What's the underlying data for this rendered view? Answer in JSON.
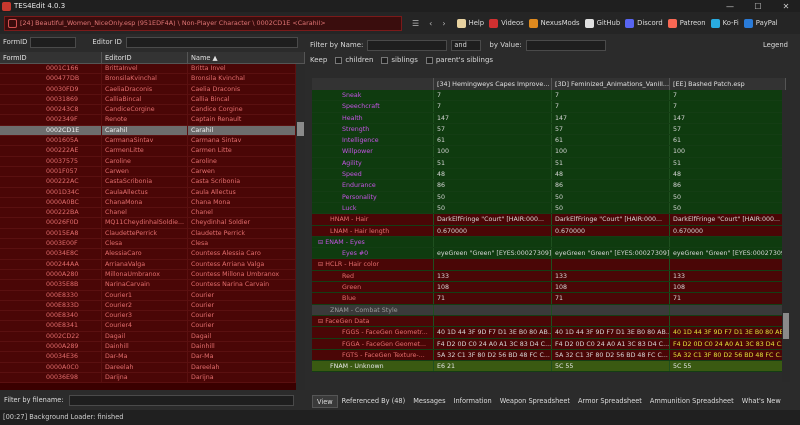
{
  "app": {
    "title": "TES4Edit 4.0.3"
  },
  "window_controls": {
    "min": "—",
    "max": "☐",
    "close": "✕"
  },
  "toolbar": {
    "path": "[24] Beautiful_Women_NiceOnly.esp (951EDF4A) \\ Non-Player Character \\ 0002CD1E <Carahil>",
    "menu_icon": "☰",
    "back": "‹",
    "fwd": "›",
    "links": [
      {
        "label": "Help",
        "icon": "book-icon",
        "color": "#e8d2a0"
      },
      {
        "label": "Videos",
        "icon": "video-icon",
        "color": "#d03030"
      },
      {
        "label": "NexusMods",
        "icon": "nexus-icon",
        "color": "#e08a1e"
      },
      {
        "label": "GitHub",
        "icon": "github-icon",
        "color": "#e0e0e0"
      },
      {
        "label": "Discord",
        "icon": "discord-icon",
        "color": "#5865f2"
      },
      {
        "label": "Patreon",
        "icon": "patreon-icon",
        "color": "#f96854"
      },
      {
        "label": "Ko-Fi",
        "icon": "kofi-icon",
        "color": "#29abe0"
      },
      {
        "label": "PayPal",
        "icon": "paypal-icon",
        "color": "#2a7bd8"
      }
    ]
  },
  "left": {
    "formid_label": "FormID",
    "editorid_label": "Editor ID",
    "columns": [
      "FormID",
      "EditorID",
      "Name ▲"
    ],
    "rows": [
      [
        "0001C166",
        "BrittaInvel",
        "Britta Invel"
      ],
      [
        "000477DB",
        "BronsilaKvinchal",
        "Bronsila Kvinchal"
      ],
      [
        "00030FD9",
        "CaeliaDraconis",
        "Caelia Draconis"
      ],
      [
        "00031869",
        "CalliaBincal",
        "Callia Bincal"
      ],
      [
        "000243C8",
        "CandiceCorgine",
        "Candice Corgine"
      ],
      [
        "0002349F",
        "Renote",
        "Captain Renault"
      ],
      [
        "0002CD1E",
        "Carahil",
        "Carahil"
      ],
      [
        "0001605A",
        "CarmanaSintav",
        "Carmana Sintav"
      ],
      [
        "000222AE",
        "CarmenLitte",
        "Carmen Litte"
      ],
      [
        "00037575",
        "Caroline",
        "Caroline"
      ],
      [
        "0001F057",
        "Carwen",
        "Carwen"
      ],
      [
        "000222AC",
        "CastaScribonia",
        "Casta Scribonia"
      ],
      [
        "0001D34C",
        "CaulaAllectus",
        "Caula Allectus"
      ],
      [
        "0000A0BC",
        "ChanaMona",
        "Chana Mona"
      ],
      [
        "000222BA",
        "Chanel",
        "Chanel"
      ],
      [
        "00026F0D",
        "MQ11CheydinhalSoldie...",
        "Cheydinhal Soldier"
      ],
      [
        "00015EA8",
        "ClaudettePerrick",
        "Claudette Perrick"
      ],
      [
        "0003E00F",
        "Clesa",
        "Clesa"
      ],
      [
        "00034E8C",
        "AlessiaCaro",
        "Countess Alessia Caro"
      ],
      [
        "000244AA",
        "ArrianaValga",
        "Countess Arriana Valga"
      ],
      [
        "0000A280",
        "MillonaUmbranox",
        "Countess Millona Umbranox"
      ],
      [
        "00035E8B",
        "NarinaCarvain",
        "Countess Narina Carvain"
      ],
      [
        "000E8330",
        "Courier1",
        "Courier"
      ],
      [
        "000E833D",
        "Courier2",
        "Courier"
      ],
      [
        "000E8340",
        "Courier3",
        "Courier"
      ],
      [
        "000E8341",
        "Courier4",
        "Courier"
      ],
      [
        "0002CD22",
        "Dagail",
        "Dagail"
      ],
      [
        "0000A289",
        "Dainhill",
        "Dainhill"
      ],
      [
        "00034E36",
        "Dar-Ma",
        "Dar-Ma"
      ],
      [
        "0000A0C0",
        "Dareelah",
        "Dareelah"
      ],
      [
        "00036E98",
        "Darijna",
        "Darijna"
      ]
    ],
    "filter_label": "Filter by filename:"
  },
  "right": {
    "filter_name_label": "Filter by Name:",
    "and_value": "and",
    "by_value_label": "by Value:",
    "legend": "Legend",
    "keep_label": "Keep",
    "keep_children": "children",
    "keep_siblings": "siblings",
    "keep_parents": "parent's siblings",
    "columns": [
      "",
      "[34] Hemingweys Capes Improve...",
      "[3D] Feminized_Animations_Vanill...",
      "[EE] Bashed Patch.esp"
    ],
    "rows": [
      {
        "cls": "g",
        "name": "Sneak",
        "indent": 2,
        "v": [
          "7",
          "7",
          "7"
        ]
      },
      {
        "cls": "g",
        "name": "Speechcraft",
        "indent": 2,
        "v": [
          "7",
          "7",
          "7"
        ]
      },
      {
        "cls": "g",
        "name": "Health",
        "indent": 2,
        "v": [
          "147",
          "147",
          "147"
        ]
      },
      {
        "cls": "g",
        "name": "Strength",
        "indent": 2,
        "v": [
          "57",
          "57",
          "57"
        ]
      },
      {
        "cls": "g",
        "name": "Intelligence",
        "indent": 2,
        "v": [
          "61",
          "61",
          "61"
        ]
      },
      {
        "cls": "g",
        "name": "Willpower",
        "indent": 2,
        "v": [
          "100",
          "100",
          "100"
        ]
      },
      {
        "cls": "g",
        "name": "Agility",
        "indent": 2,
        "v": [
          "51",
          "51",
          "51"
        ]
      },
      {
        "cls": "g",
        "name": "Speed",
        "indent": 2,
        "v": [
          "48",
          "48",
          "48"
        ]
      },
      {
        "cls": "g",
        "name": "Endurance",
        "indent": 2,
        "v": [
          "86",
          "86",
          "86"
        ]
      },
      {
        "cls": "g",
        "name": "Personality",
        "indent": 2,
        "v": [
          "50",
          "50",
          "50"
        ]
      },
      {
        "cls": "g",
        "name": "Luck",
        "indent": 2,
        "v": [
          "50",
          "50",
          "50"
        ]
      },
      {
        "cls": "r",
        "name": "HNAM - Hair",
        "indent": 1,
        "v": [
          "DarkElfFringe \"Court\" [HAIR:000...",
          "DarkElfFringe \"Court\" [HAIR:000...",
          "DarkElfFringe \"Court\" [HAIR:000..."
        ]
      },
      {
        "cls": "r",
        "name": "LNAM - Hair length",
        "indent": 1,
        "v": [
          "0.670000",
          "0.670000",
          "0.670000"
        ]
      },
      {
        "cls": "g",
        "name": "⊟ ENAM - Eyes",
        "indent": 0,
        "v": [
          "",
          "",
          ""
        ]
      },
      {
        "cls": "g",
        "name": "Eyes #0",
        "indent": 2,
        "v": [
          "eyeGreen \"Green\" [EYES:00027309]",
          "eyeGreen \"Green\" [EYES:00027309]",
          "eyeGreen \"Green\" [EYES:00027309]"
        ]
      },
      {
        "cls": "r",
        "name": "⊟ HCLR - Hair color",
        "indent": 0,
        "v": [
          "",
          "",
          ""
        ]
      },
      {
        "cls": "r",
        "name": "Red",
        "indent": 2,
        "v": [
          "133",
          "133",
          "133"
        ]
      },
      {
        "cls": "r",
        "name": "Green",
        "indent": 2,
        "v": [
          "108",
          "108",
          "108"
        ]
      },
      {
        "cls": "r",
        "name": "Blue",
        "indent": 2,
        "v": [
          "71",
          "71",
          "71"
        ]
      },
      {
        "cls": "gray",
        "name": "ZNAM - Combat Style",
        "indent": 1,
        "v": [
          "",
          "",
          ""
        ]
      },
      {
        "cls": "r",
        "name": "⊟ FaceGen Data",
        "indent": 0,
        "v": [
          "",
          "",
          ""
        ]
      },
      {
        "cls": "r",
        "name": "FGGS - FaceGen Geometr...",
        "indent": 2,
        "v": [
          "40 1D 44 3F 9D F7 D1 3E B0 80 AB...",
          "40 1D 44 3F 9D F7 D1 3E B0 80 AB...",
          "40 1D 44 3F 9D F7 D1 3E B0 80 AB..."
        ],
        "yel": true
      },
      {
        "cls": "r",
        "name": "FGGA - FaceGen Geomet...",
        "indent": 2,
        "v": [
          "F4 D2 0D C0 24 A0 A1 3C 83 D4 C...",
          "F4 D2 0D C0 24 A0 A1 3C 83 D4 C...",
          "F4 D2 0D C0 24 A0 A1 3C 83 D4 C..."
        ],
        "yel": true
      },
      {
        "cls": "r",
        "name": "FGTS - FaceGen Texture-...",
        "indent": 2,
        "v": [
          "5A 32 C1 3F 80 D2 56 BD 48 FC C...",
          "5A 32 C1 3F 80 D2 56 BD 48 FC C...",
          "5A 32 C1 3F 80 D2 56 BD 48 FC C..."
        ],
        "yel": true
      },
      {
        "cls": "sel2",
        "name": "FNAM - Unknown",
        "indent": 1,
        "v": [
          "E6 21",
          "5C 55",
          "5C 55"
        ]
      }
    ],
    "tabs": [
      "View",
      "Referenced By (48)",
      "Messages",
      "Information",
      "Weapon Spreadsheet",
      "Armor Spreadsheet",
      "Ammunition Spreadsheet",
      "What's New"
    ]
  },
  "status": "[00:27] Background Loader: finished"
}
